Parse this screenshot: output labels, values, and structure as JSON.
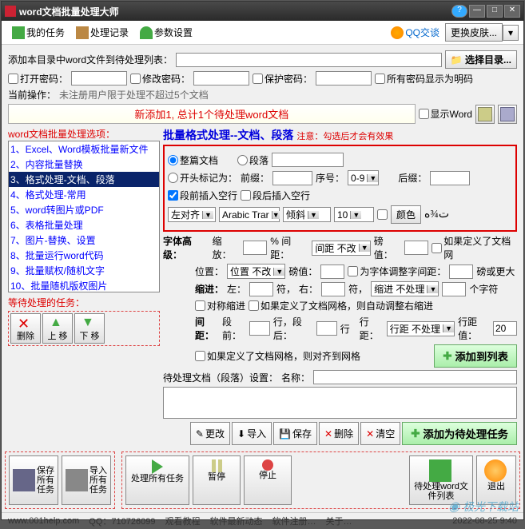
{
  "title": "word文档批量处理大师",
  "toolbar": {
    "my_tasks": "我的任务",
    "history": "处理记录",
    "params": "参数设置",
    "qq": "QQ交谈",
    "skin": "更换皮肤..."
  },
  "add_hint": "添加本目录中word文件到待处理列表：",
  "select_dir": "选择目录...",
  "pwd": {
    "open": "打开密码：",
    "modify": "修改密码：",
    "protect": "保护密码：",
    "plaintext": "所有密码显示为明码"
  },
  "current_op_label": "当前操作：",
  "current_op": "未注册用户限于处理不超过5个文档",
  "status_msg": "新添加1, 总计1个待处理word文档",
  "show_word": "显示Word",
  "left": {
    "title": "word文档批量处理选项：",
    "items": [
      "1、Excel、Word模板批量新文件",
      "2、内容批量替换",
      "3、格式处理-文档、段落",
      "4、格式处理-常用",
      "5、word转图片或PDF",
      "6、表格批量处理",
      "7、图片-替换、设置",
      "8、批量运行word代码",
      "9、批量赋权/随机文字",
      "10、批量随机版权图片"
    ],
    "selected_index": 2,
    "pending_title": "等待处理的任务：",
    "btn_delete": "删除",
    "btn_up": "上\n移",
    "btn_down": "下\n移"
  },
  "right": {
    "section_title": "批量格式处理--文档、段落",
    "note": "注意：勾选后才会有效果",
    "whole_doc": "整篇文档",
    "paragraph": "段落",
    "start_mark": "开头标记为：",
    "prefix": "前缀：",
    "seq": "序号：",
    "seq_val": "0-9",
    "suffix": "后缀：",
    "insert_blank_before": "段前插入空行",
    "insert_blank_after": "段后插入空行",
    "align": "左对齐",
    "font": "Arabic Trar",
    "style": "倾斜",
    "size": "10",
    "color": "颜色",
    "arabic_sample": "ت¾ه",
    "font_advanced": "字体高级：",
    "scale": "缩放：",
    "spacing_pct": "% 间距：",
    "spacing_val": "间距 不改",
    "pt1": "磅值：",
    "if_defined_font": "如果定义了文档网",
    "position": "位置：",
    "position_val": "位置 不改",
    "pt2": "磅值：",
    "adjust_font_spacing": "为字体调整字间距：",
    "pt_or_more": "磅或更大",
    "indent": "缩进：",
    "left_lbl": "左：",
    "char1": "符，",
    "right_lbl": "右：",
    "char2": "符，",
    "indent_val": "缩进 不处理",
    "chars": "个字符",
    "sym_indent": "对称缩进",
    "auto_adjust": "如果定义了文档网格，则自动调整右缩进",
    "spacing": "间距：",
    "before_para": "段前：",
    "line1": "行，段后：",
    "line2": "行",
    "line_spacing_lbl": "行距：",
    "line_spacing_val": "行距 不处理",
    "line_spacing_val2": "行距值：",
    "line_spacing_num": "20",
    "align_grid": "如果定义了文档网格，则对齐到网格",
    "add_to_list": "添加到列表",
    "pending_doc": "待处理文档（段落）设置：",
    "name": "名称：",
    "btn_modify": "更改",
    "btn_import": "导入",
    "btn_save": "保存",
    "btn_delete": "删除",
    "btn_clear": "清空",
    "add_task": "添加为待处理任务"
  },
  "footer": {
    "save_all": "保存\n所有\n任务",
    "import_all": "导入\n所有\n任务",
    "process_all": "处理所有任务",
    "pause": "暂停",
    "stop": "停止",
    "pending_list": "待处理word文\n件列表",
    "exit": "退出"
  },
  "status": {
    "url": "www.001help.com",
    "qq": "QQ：710726099",
    "tutorial": "观看教程",
    "news": "软件最新动态",
    "reg": "软件注册…",
    "about": "关于…",
    "time": "2022-08-25 9:40"
  },
  "watermark": "极光下载站"
}
